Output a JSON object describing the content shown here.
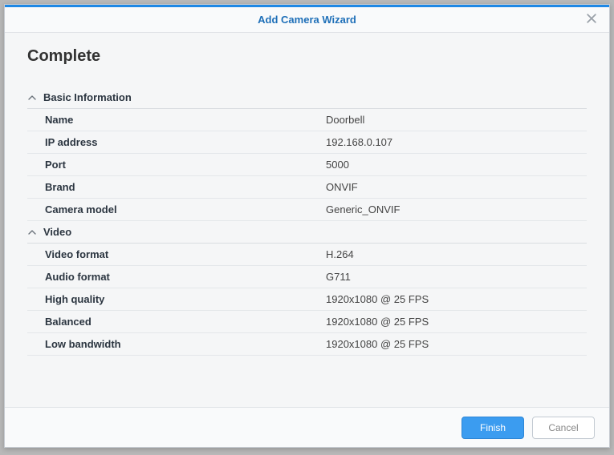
{
  "window": {
    "title": "Add Camera Wizard"
  },
  "page": {
    "heading": "Complete"
  },
  "sections": {
    "basic": {
      "title": "Basic Information",
      "rows": {
        "name": {
          "label": "Name",
          "value": "Doorbell"
        },
        "ip": {
          "label": "IP address",
          "value": "192.168.0.107"
        },
        "port": {
          "label": "Port",
          "value": "5000"
        },
        "brand": {
          "label": "Brand",
          "value": "ONVIF"
        },
        "model": {
          "label": "Camera model",
          "value": "Generic_ONVIF"
        }
      }
    },
    "video": {
      "title": "Video",
      "rows": {
        "vformat": {
          "label": "Video format",
          "value": "H.264"
        },
        "aformat": {
          "label": "Audio format",
          "value": "G711"
        },
        "high": {
          "label": "High quality",
          "value": "1920x1080 @ 25 FPS"
        },
        "balanced": {
          "label": "Balanced",
          "value": "1920x1080 @ 25 FPS"
        },
        "low": {
          "label": "Low bandwidth",
          "value": "1920x1080 @ 25 FPS"
        }
      }
    }
  },
  "footer": {
    "finish": "Finish",
    "cancel": "Cancel"
  }
}
